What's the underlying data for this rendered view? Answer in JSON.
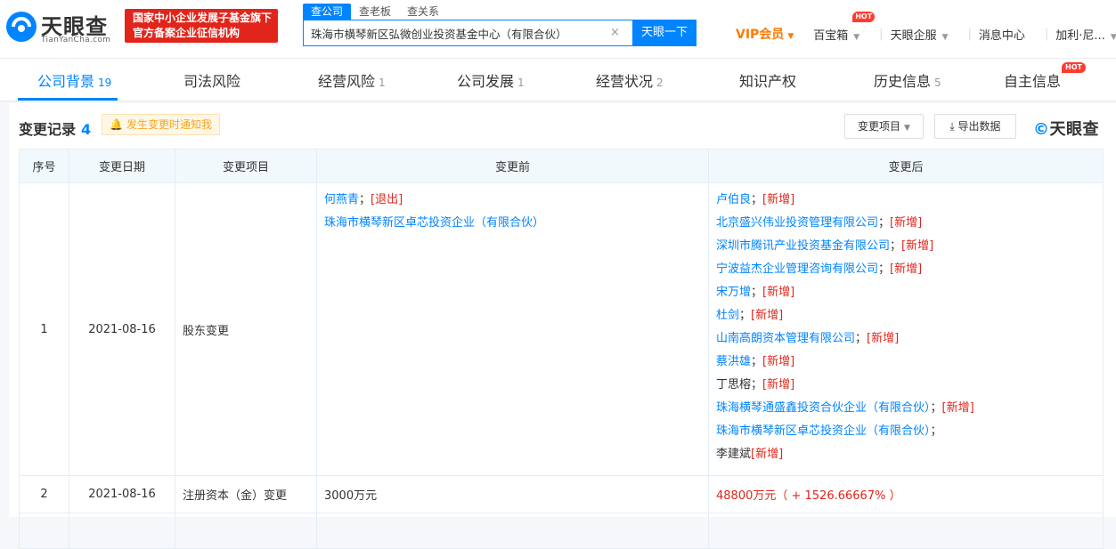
{
  "header": {
    "logo_text": "天眼查",
    "logo_sub": "TianYanCha.com",
    "gov_badge_line1": "国家中小企业发展子基金旗下",
    "gov_badge_line2": "官方备案企业征信机构",
    "search_tabs": [
      "查公司",
      "查老板",
      "查关系"
    ],
    "search_value": "珠海市横琴新区弘微创业投资基金中心（有限合伙）",
    "search_clear": "×",
    "search_button": "天眼一下",
    "vip_label": "VIP会员",
    "nav": {
      "baobao": "百宝箱",
      "hot": "HOT",
      "qifu": "天眼企服",
      "messages": "消息中心",
      "user": "加利·尼..."
    }
  },
  "tabs": [
    {
      "label": "公司背景",
      "count": "19"
    },
    {
      "label": "司法风险",
      "count": ""
    },
    {
      "label": "经营风险",
      "count": "1"
    },
    {
      "label": "公司发展",
      "count": "1"
    },
    {
      "label": "经营状况",
      "count": "2"
    },
    {
      "label": "知识产权",
      "count": ""
    },
    {
      "label": "历史信息",
      "count": "5"
    },
    {
      "label": "自主信息",
      "count": ""
    }
  ],
  "tab_hot": "HOT",
  "section": {
    "title": "变更记录",
    "count": "4",
    "notify": "发生变更时通知我",
    "filter_button": "变更项目",
    "export_button": "导出数据",
    "brand": "天眼查"
  },
  "table": {
    "headers": [
      "序号",
      "变更日期",
      "变更项目",
      "变更前",
      "变更后"
    ],
    "rows": [
      {
        "no": "1",
        "date": "2021-08-16",
        "item": "股东变更",
        "before": [
          {
            "name": "何燕青",
            "sep": "；",
            "tag": "[退出]",
            "link": true
          },
          {
            "name": "珠海市横琴新区卓芯投资企业（有限合伙）",
            "sep": "",
            "tag": "",
            "link": true
          }
        ],
        "after": [
          {
            "name": "卢伯良",
            "sep": "；",
            "tag": "[新增]",
            "link": true
          },
          {
            "name": "北京盛兴伟业投资管理有限公司",
            "sep": "；",
            "tag": "[新增]",
            "link": true
          },
          {
            "name": "深圳市腾讯产业投资基金有限公司",
            "sep": "；",
            "tag": "[新增]",
            "link": true
          },
          {
            "name": "宁波益杰企业管理咨询有限公司",
            "sep": "；",
            "tag": "[新增]",
            "link": true
          },
          {
            "name": "宋万增",
            "sep": "；",
            "tag": "[新增]",
            "link": true
          },
          {
            "name": "杜剑",
            "sep": "；",
            "tag": "[新增]",
            "link": true
          },
          {
            "name": "山南高朗资本管理有限公司",
            "sep": "；",
            "tag": "[新增]",
            "link": true
          },
          {
            "name": "蔡洪雄",
            "sep": "；",
            "tag": "[新增]",
            "link": true
          },
          {
            "name": "丁思榕",
            "sep": "；",
            "tag": "[新增]",
            "link": false
          },
          {
            "name": "珠海横琴通盛鑫投资合伙企业（有限合伙）",
            "sep": "；",
            "tag": "[新增]",
            "link": true
          },
          {
            "name": "珠海市横琴新区卓芯投资企业（有限合伙）",
            "sep": "；",
            "tag": "",
            "link": true
          },
          {
            "name": "李建斌",
            "sep": "",
            "tag": "[新增]",
            "link": false
          }
        ]
      },
      {
        "no": "2",
        "date": "2021-08-16",
        "item": "注册资本（金）变更",
        "before_text": "3000万元",
        "after_text": "48800万元（ + 1526.66667% ）"
      }
    ]
  }
}
